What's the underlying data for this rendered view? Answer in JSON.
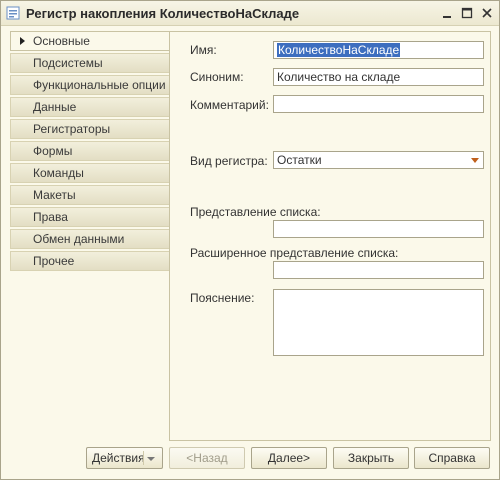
{
  "window": {
    "title": "Регистр накопления КоличествоНаСкладе"
  },
  "sidebar": {
    "items": [
      {
        "label": "Основные",
        "active": true
      },
      {
        "label": "Подсистемы"
      },
      {
        "label": "Функциональные опции"
      },
      {
        "label": "Данные"
      },
      {
        "label": "Регистраторы"
      },
      {
        "label": "Формы"
      },
      {
        "label": "Команды"
      },
      {
        "label": "Макеты"
      },
      {
        "label": "Права"
      },
      {
        "label": "Обмен данными"
      },
      {
        "label": "Прочее"
      }
    ]
  },
  "form": {
    "name_label": "Имя:",
    "name_value": "КоличествоНаСкладе",
    "synonym_label": "Синоним:",
    "synonym_value": "Количество на складе",
    "comment_label": "Комментарий:",
    "comment_value": "",
    "register_type_label": "Вид регистра:",
    "register_type_value": "Остатки",
    "list_presentation_label": "Представление списка:",
    "list_presentation_value": "",
    "extended_list_presentation_label": "Расширенное представление списка:",
    "extended_list_presentation_value": "",
    "explanation_label": "Пояснение:",
    "explanation_value": ""
  },
  "buttons": {
    "actions": "Действия",
    "back": "<Назад",
    "next": "Далее>",
    "close": "Закрыть",
    "help": "Справка"
  },
  "icons": [
    "register-icon",
    "minimize-icon",
    "maximize-icon",
    "close-icon",
    "active-item-arrow-icon",
    "dropdown-arrow-icon",
    "chevron-down-icon"
  ],
  "colors": {
    "accent_selection": "#3d6ebf",
    "dropdown_arrow": "#c0601c",
    "window_bg": "#fbf9ea"
  }
}
